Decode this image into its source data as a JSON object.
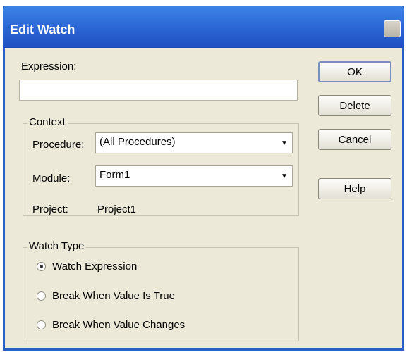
{
  "window": {
    "title": "Edit Watch"
  },
  "expression": {
    "label": "Expression:",
    "value": ""
  },
  "context": {
    "legend": "Context",
    "procedure": {
      "label": "Procedure:",
      "value": "(All Procedures)"
    },
    "module": {
      "label": "Module:",
      "value": "Form1"
    },
    "project": {
      "label": "Project:",
      "value": "Project1"
    }
  },
  "watch_type": {
    "legend": "Watch Type",
    "options": [
      {
        "label": "Watch Expression",
        "selected": true
      },
      {
        "label": "Break When Value Is True",
        "selected": false
      },
      {
        "label": "Break When Value Changes",
        "selected": false
      }
    ]
  },
  "buttons": {
    "ok": "OK",
    "delete": "Delete",
    "cancel": "Cancel",
    "help": "Help"
  },
  "icons": {
    "close": "close-icon",
    "dropdown": "chevron-down-icon"
  },
  "colors": {
    "titlebar": "#2e6ad8",
    "dialog_bg": "#ece9d8"
  }
}
